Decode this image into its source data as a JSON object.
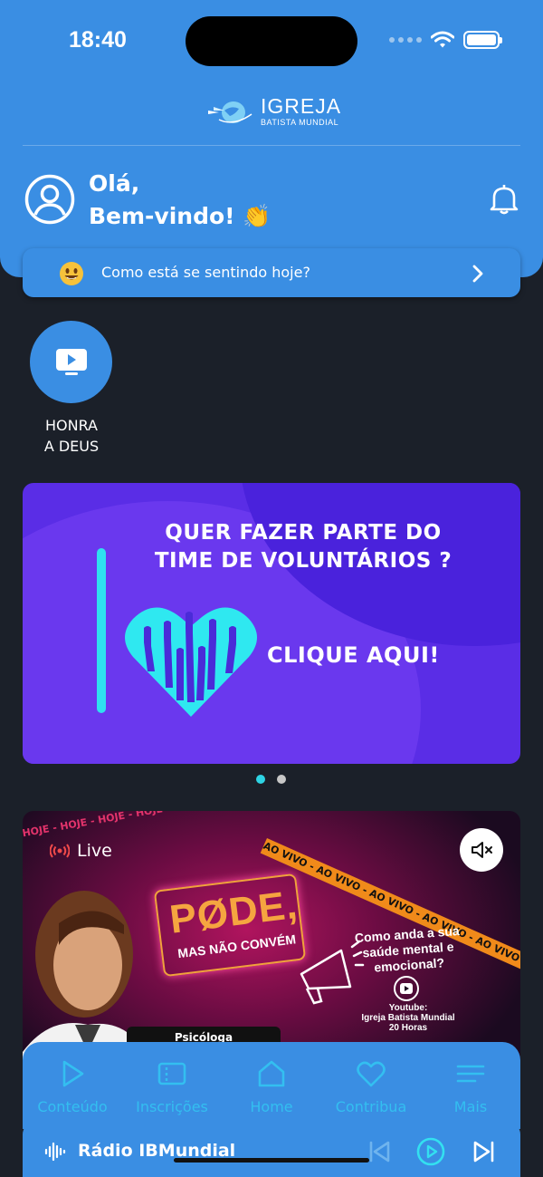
{
  "status_bar": {
    "time": "18:40"
  },
  "brand": {
    "logo_text": "IGREJA",
    "logo_subtext": "BATISTA MUNDIAL"
  },
  "greeting": {
    "line1": "Olá,",
    "line2": "Bem-vindo! 👏"
  },
  "mood_prompt": {
    "emoji": "😀",
    "text": "Como está se sentindo hoje?"
  },
  "shortcuts": [
    {
      "label_line1": "HONRA",
      "label_line2": "A DEUS",
      "icon": "tv-play-icon"
    }
  ],
  "banner": {
    "headline_line1": "QUER FAZER PARTE DO",
    "headline_line2": "TIME DE VOLUNTÁRIOS ?",
    "cta": "CLIQUE AQUI!",
    "slide_count": 2,
    "active_slide": 1
  },
  "live": {
    "badge": "Live",
    "tape_orange": "AO VIVO - AO VIVO - AO VIVO - AO VIVO - AO VIVO -",
    "tape_pink": "- HOJE - HOJE - HOJE - HOJE - HOJE - HOJE -",
    "logo_big": "PØDE,",
    "logo_small": "MAS NÃO CONVÉM",
    "question": "Como anda a sua saúde mental e emocional?",
    "youtube_label": "Youtube:",
    "youtube_channel": "Igreja Batista Mundial",
    "youtube_time": "20 Horas",
    "name_plate": "Psicóloga"
  },
  "tabs": [
    {
      "label": "Conteúdo",
      "icon": "play-icon"
    },
    {
      "label": "Inscrições",
      "icon": "ticket-icon"
    },
    {
      "label": "Home",
      "icon": "home-icon"
    },
    {
      "label": "Contribua",
      "icon": "heart-icon"
    },
    {
      "label": "Mais",
      "icon": "menu-icon"
    }
  ],
  "player": {
    "title": "Rádio IBMundial"
  },
  "colors": {
    "primary": "#3a8ee3",
    "background": "#1b2029",
    "tab_label": "#33bff0",
    "accent": "#2ed4e4"
  }
}
